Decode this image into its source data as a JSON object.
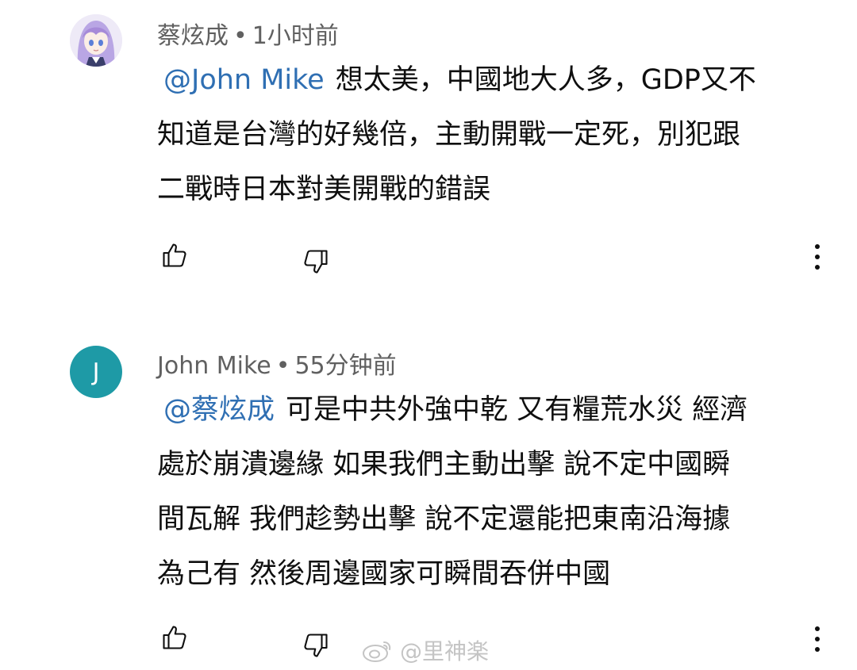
{
  "comments": [
    {
      "author": "蔡炫成",
      "time": "1小时前",
      "mention": "@John Mike",
      "lines": [
        "想太美，中國地大人多，GDP又不",
        "知道是台灣的好幾倍，主動開戰一定死，別犯跟",
        "二戰時日本對美開戰的錯誤"
      ],
      "avatar": "anime-girl-avatar"
    },
    {
      "author": "John Mike",
      "time": "55分钟前",
      "mention": "@蔡炫成",
      "avatar_letter": "J",
      "avatar_color": "#1e9aa6",
      "lines": [
        "可是中共外強中乾 又有糧荒水災 經濟",
        "處於崩潰邊緣 如果我們主動出擊 說不定中國瞬",
        "間瓦解 我們趁勢出擊 說不定還能把東南沿海據",
        "為己有 然後周邊國家可瞬間吞併中國"
      ]
    }
  ],
  "separator": "•",
  "icons": {
    "like": "thumbs-up-icon",
    "dislike": "thumbs-down-icon",
    "more": "more-vertical-icon"
  },
  "watermark": {
    "text": "@里神楽",
    "icon": "weibo-icon"
  }
}
